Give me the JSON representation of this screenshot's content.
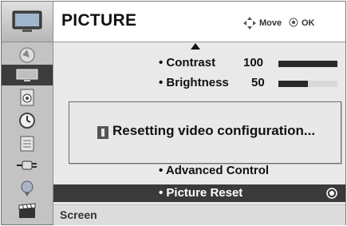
{
  "header": {
    "title": "PICTURE",
    "hint_move": "Move",
    "hint_ok": "OK"
  },
  "menu": {
    "contrast": {
      "label": "• Contrast",
      "value": "100",
      "level": 1.0
    },
    "brightness": {
      "label": "• Brightness",
      "value": "50",
      "level": 0.5
    },
    "advanced": {
      "label": "• Advanced Control"
    },
    "reset": {
      "label": "• Picture Reset"
    }
  },
  "footer": {
    "label": "Screen"
  },
  "dialog": {
    "message": "Resetting video configuration..."
  },
  "icons": {
    "tv": "tv-icon",
    "sidebar": [
      "setup-icon",
      "picture-icon",
      "audio-icon",
      "time-icon",
      "option-icon",
      "input-icon",
      "usb-icon",
      "movie-icon"
    ],
    "move": "navigation-arrows-icon",
    "ok": "ok-button-icon",
    "info": "info-icon"
  },
  "colors": {
    "selected_bg": "#3a3a3a",
    "bar_fill": "#2a2a2a",
    "bar_track": "#d8d8d8"
  }
}
